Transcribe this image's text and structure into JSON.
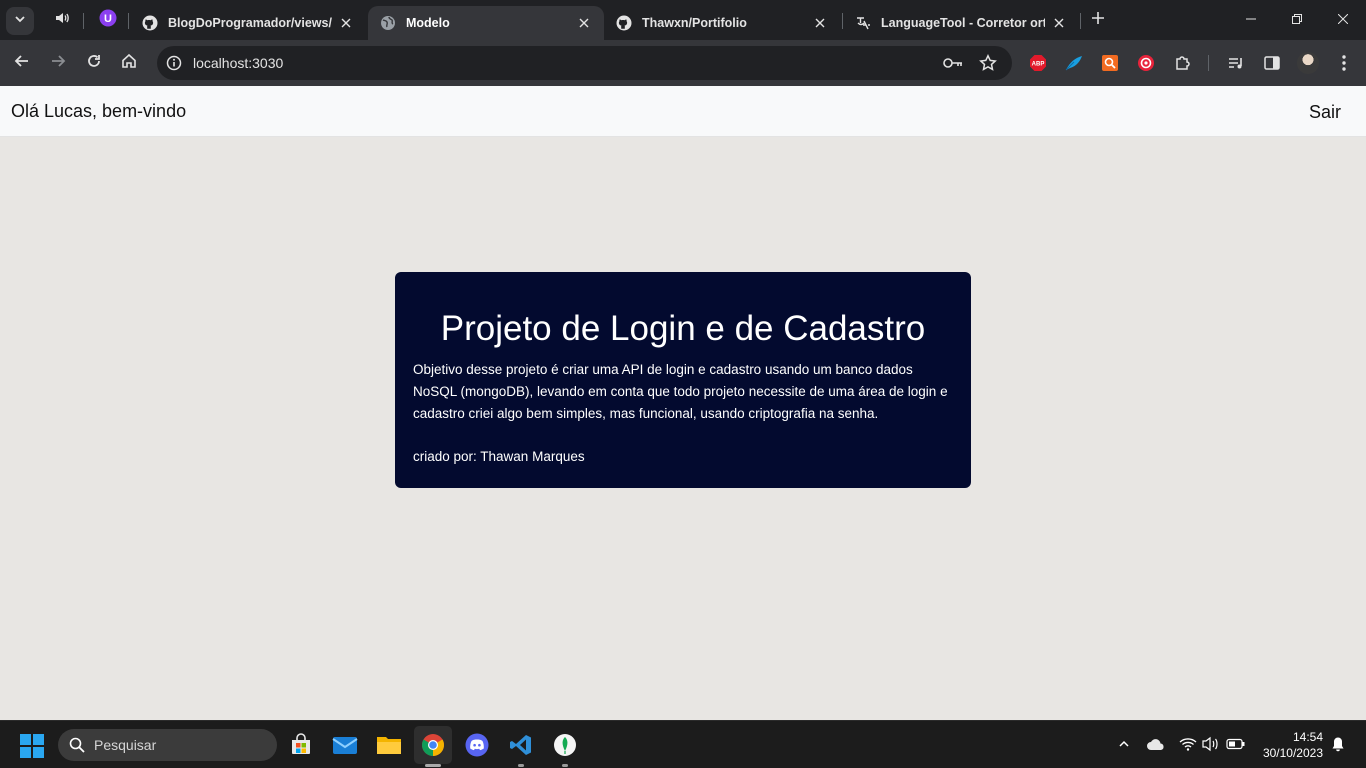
{
  "browser": {
    "tabs": [
      {
        "title": "BlogDoProgramador/views/pa",
        "icon": "github-icon",
        "active": false
      },
      {
        "title": "Modelo",
        "icon": "globe-icon",
        "active": true
      },
      {
        "title": "Thawxn/Portifolio",
        "icon": "github-icon",
        "active": false
      },
      {
        "title": "LanguageTool - Corretor ortog",
        "icon": "languagetool-icon",
        "active": false
      }
    ],
    "url": "localhost:3030",
    "extensions": [
      {
        "name": "adblock-plus-icon",
        "label": "ABP",
        "color": "#e21a2b"
      },
      {
        "name": "feather-extension-icon",
        "color": "#1a9fe0"
      },
      {
        "name": "orange-extension-icon",
        "color": "#f26b21"
      },
      {
        "name": "target-extension-icon",
        "color": "#e8233b"
      }
    ]
  },
  "page": {
    "greeting": "Olá Lucas, bem-vindo",
    "logout_label": "Sair",
    "card": {
      "title": "Projeto de Login e de Cadastro",
      "description": "Objetivo desse projeto é criar uma API de login e cadastro usando um banco dados NoSQL (mongoDB), levando em conta que todo projeto necessite de uma área de login e cadastro criei algo bem simples, mas funcional, usando criptografia na senha.",
      "author": "criado por: Thawan Marques",
      "background": "#030a2f"
    }
  },
  "taskbar": {
    "search_placeholder": "Pesquisar",
    "apps": [
      "store-icon",
      "mail-icon",
      "file-explorer-icon",
      "chrome-icon",
      "discord-icon",
      "vscode-icon",
      "mongodb-compass-icon"
    ],
    "time": "14:54",
    "date": "30/10/2023"
  }
}
